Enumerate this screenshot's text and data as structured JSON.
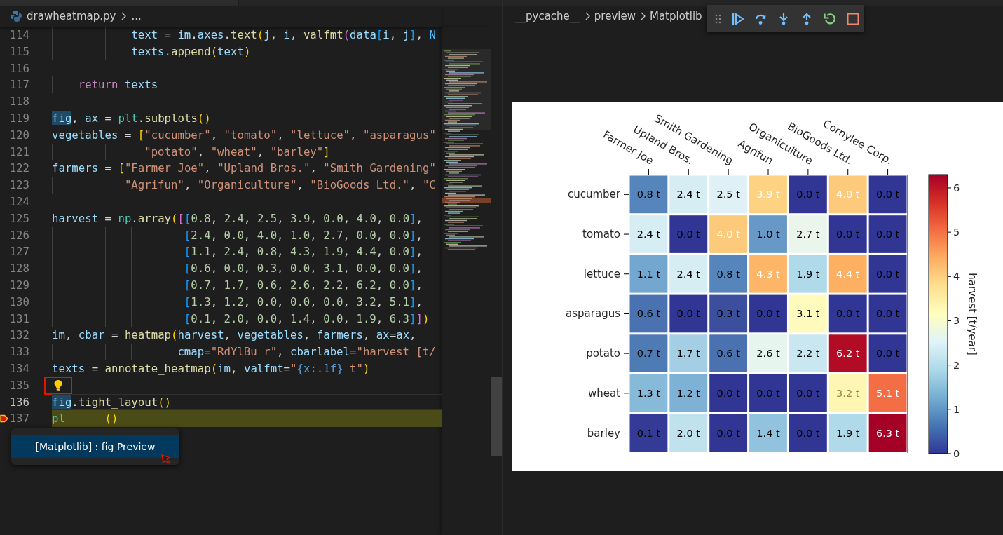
{
  "editor": {
    "file": "drawheatmap.py",
    "breadcrumb_more": "...",
    "lines": [
      {
        "number": "114",
        "current": false,
        "paused": false,
        "lightbulb": false,
        "tokens": [
          {
            "text": "            text",
            "kind": "var"
          },
          {
            "text": " = ",
            "kind": "plain"
          },
          {
            "text": "im",
            "kind": "var"
          },
          {
            "text": ".",
            "kind": "plain"
          },
          {
            "text": "axes",
            "kind": "var"
          },
          {
            "text": ".",
            "kind": "plain"
          },
          {
            "text": "text",
            "kind": "func"
          },
          {
            "text": "(",
            "kind": "b1"
          },
          {
            "text": "j",
            "kind": "var"
          },
          {
            "text": ", ",
            "kind": "plain"
          },
          {
            "text": "i",
            "kind": "var"
          },
          {
            "text": ", ",
            "kind": "plain"
          },
          {
            "text": "valfmt",
            "kind": "func"
          },
          {
            "text": "(",
            "kind": "b2"
          },
          {
            "text": "data",
            "kind": "var"
          },
          {
            "text": "[",
            "kind": "b3"
          },
          {
            "text": "i",
            "kind": "var"
          },
          {
            "text": ", ",
            "kind": "plain"
          },
          {
            "text": "j",
            "kind": "var"
          },
          {
            "text": "]",
            "kind": "b3"
          },
          {
            "text": ", ",
            "kind": "plain"
          },
          {
            "text": "N",
            "kind": "const"
          }
        ]
      },
      {
        "number": "115",
        "current": false,
        "paused": false,
        "lightbulb": false,
        "tokens": [
          {
            "text": "            texts",
            "kind": "var"
          },
          {
            "text": ".",
            "kind": "plain"
          },
          {
            "text": "append",
            "kind": "func"
          },
          {
            "text": "(",
            "kind": "b1"
          },
          {
            "text": "text",
            "kind": "var"
          },
          {
            "text": ")",
            "kind": "b1"
          }
        ]
      },
      {
        "number": "116",
        "current": false,
        "paused": false,
        "lightbulb": false
      },
      {
        "number": "117",
        "current": false,
        "paused": false,
        "lightbulb": false,
        "tokens": [
          {
            "text": "    return",
            "kind": "kw"
          },
          {
            "text": " texts",
            "kind": "var"
          }
        ]
      },
      {
        "number": "118",
        "current": false,
        "paused": false,
        "lightbulb": false
      },
      {
        "number": "119",
        "current": false,
        "paused": false,
        "lightbulb": false,
        "tokens": [
          {
            "text": "fig",
            "kind": "var",
            "highlight": true
          },
          {
            "text": ", ",
            "kind": "plain"
          },
          {
            "text": "ax",
            "kind": "var"
          },
          {
            "text": " = ",
            "kind": "plain"
          },
          {
            "text": "plt",
            "kind": "cls"
          },
          {
            "text": ".",
            "kind": "plain"
          },
          {
            "text": "subplots",
            "kind": "func"
          },
          {
            "text": "()",
            "kind": "b1"
          }
        ]
      },
      {
        "number": "120",
        "current": false,
        "paused": false,
        "lightbulb": false,
        "tokens": [
          {
            "text": "vegetables",
            "kind": "var"
          },
          {
            "text": " = ",
            "kind": "plain"
          },
          {
            "text": "[",
            "kind": "b1"
          },
          {
            "text": "\"cucumber\"",
            "kind": "str"
          },
          {
            "text": ", ",
            "kind": "plain"
          },
          {
            "text": "\"tomato\"",
            "kind": "str"
          },
          {
            "text": ", ",
            "kind": "plain"
          },
          {
            "text": "\"lettuce\"",
            "kind": "str"
          },
          {
            "text": ", ",
            "kind": "plain"
          },
          {
            "text": "\"asparagus\"",
            "kind": "str"
          }
        ]
      },
      {
        "number": "121",
        "current": false,
        "paused": false,
        "lightbulb": false,
        "tokens": [
          {
            "text": "              \"potato\"",
            "kind": "str"
          },
          {
            "text": ", ",
            "kind": "plain"
          },
          {
            "text": "\"wheat\"",
            "kind": "str"
          },
          {
            "text": ", ",
            "kind": "plain"
          },
          {
            "text": "\"barley\"",
            "kind": "str"
          },
          {
            "text": "]",
            "kind": "b1"
          }
        ]
      },
      {
        "number": "122",
        "current": false,
        "paused": false,
        "lightbulb": false,
        "tokens": [
          {
            "text": "farmers",
            "kind": "var"
          },
          {
            "text": " = ",
            "kind": "plain"
          },
          {
            "text": "[",
            "kind": "b1"
          },
          {
            "text": "\"Farmer Joe\"",
            "kind": "str"
          },
          {
            "text": ", ",
            "kind": "plain"
          },
          {
            "text": "\"Upland Bros.\"",
            "kind": "str"
          },
          {
            "text": ", ",
            "kind": "plain"
          },
          {
            "text": "\"Smith Gardening\"",
            "kind": "str"
          }
        ]
      },
      {
        "number": "123",
        "current": false,
        "paused": false,
        "lightbulb": false,
        "tokens": [
          {
            "text": "           \"Agrifun\"",
            "kind": "str"
          },
          {
            "text": ", ",
            "kind": "plain"
          },
          {
            "text": "\"Organiculture\"",
            "kind": "str"
          },
          {
            "text": ", ",
            "kind": "plain"
          },
          {
            "text": "\"BioGoods Ltd.\"",
            "kind": "str"
          },
          {
            "text": ", ",
            "kind": "plain"
          },
          {
            "text": "\"C",
            "kind": "str"
          }
        ]
      },
      {
        "number": "124",
        "current": false,
        "paused": false,
        "lightbulb": false
      },
      {
        "number": "125",
        "current": false,
        "paused": false,
        "lightbulb": false,
        "tokens": [
          {
            "text": "harvest",
            "kind": "var"
          },
          {
            "text": " = ",
            "kind": "plain"
          },
          {
            "text": "np",
            "kind": "cls"
          },
          {
            "text": ".",
            "kind": "plain"
          },
          {
            "text": "array",
            "kind": "func"
          },
          {
            "text": "(",
            "kind": "b1"
          },
          {
            "text": "[",
            "kind": "b2"
          },
          {
            "text": "[",
            "kind": "b3"
          },
          {
            "text": "0.8, 2.4, 2.5, 3.9, 0.0, 4.0, 0.0",
            "kind": "nums"
          },
          {
            "text": "]",
            "kind": "b3"
          },
          {
            "text": ",",
            "kind": "plain"
          }
        ]
      },
      {
        "number": "126",
        "current": false,
        "paused": false,
        "lightbulb": false,
        "tokens": [
          {
            "text": "                    [",
            "kind": "b3"
          },
          {
            "text": "2.4, 0.0, 4.0, 1.0, 2.7, 0.0, 0.0",
            "kind": "nums"
          },
          {
            "text": "]",
            "kind": "b3"
          },
          {
            "text": ",",
            "kind": "plain"
          }
        ]
      },
      {
        "number": "127",
        "current": false,
        "paused": false,
        "lightbulb": false,
        "tokens": [
          {
            "text": "                    [",
            "kind": "b3"
          },
          {
            "text": "1.1, 2.4, 0.8, 4.3, 1.9, 4.4, 0.0",
            "kind": "nums"
          },
          {
            "text": "]",
            "kind": "b3"
          },
          {
            "text": ",",
            "kind": "plain"
          }
        ]
      },
      {
        "number": "128",
        "current": false,
        "paused": false,
        "lightbulb": false,
        "tokens": [
          {
            "text": "                    [",
            "kind": "b3"
          },
          {
            "text": "0.6, 0.0, 0.3, 0.0, 3.1, 0.0, 0.0",
            "kind": "nums"
          },
          {
            "text": "]",
            "kind": "b3"
          },
          {
            "text": ",",
            "kind": "plain"
          }
        ]
      },
      {
        "number": "129",
        "current": false,
        "paused": false,
        "lightbulb": false,
        "tokens": [
          {
            "text": "                    [",
            "kind": "b3"
          },
          {
            "text": "0.7, 1.7, 0.6, 2.6, 2.2, 6.2, 0.0",
            "kind": "nums"
          },
          {
            "text": "]",
            "kind": "b3"
          },
          {
            "text": ",",
            "kind": "plain"
          }
        ]
      },
      {
        "number": "130",
        "current": false,
        "paused": false,
        "lightbulb": false,
        "tokens": [
          {
            "text": "                    [",
            "kind": "b3"
          },
          {
            "text": "1.3, 1.2, 0.0, 0.0, 0.0, 3.2, 5.1",
            "kind": "nums"
          },
          {
            "text": "]",
            "kind": "b3"
          },
          {
            "text": ",",
            "kind": "plain"
          }
        ]
      },
      {
        "number": "131",
        "current": false,
        "paused": false,
        "lightbulb": false,
        "tokens": [
          {
            "text": "                    [",
            "kind": "b3"
          },
          {
            "text": "0.1, 2.0, 0.0, 1.4, 0.0, 1.9, 6.3",
            "kind": "nums"
          },
          {
            "text": "]",
            "kind": "b3"
          },
          {
            "text": "]",
            "kind": "b2"
          },
          {
            "text": ")",
            "kind": "b1"
          }
        ]
      },
      {
        "number": "132",
        "current": false,
        "paused": false,
        "lightbulb": false,
        "tokens": [
          {
            "text": "im",
            "kind": "var"
          },
          {
            "text": ", ",
            "kind": "plain"
          },
          {
            "text": "cbar",
            "kind": "var"
          },
          {
            "text": " = ",
            "kind": "plain"
          },
          {
            "text": "heatmap",
            "kind": "func"
          },
          {
            "text": "(",
            "kind": "b1"
          },
          {
            "text": "harvest",
            "kind": "var"
          },
          {
            "text": ", ",
            "kind": "plain"
          },
          {
            "text": "vegetables",
            "kind": "var"
          },
          {
            "text": ", ",
            "kind": "plain"
          },
          {
            "text": "farmers",
            "kind": "var"
          },
          {
            "text": ", ",
            "kind": "plain"
          },
          {
            "text": "ax",
            "kind": "var"
          },
          {
            "text": "=",
            "kind": "plain"
          },
          {
            "text": "ax",
            "kind": "var"
          },
          {
            "text": ",",
            "kind": "plain"
          }
        ]
      },
      {
        "number": "133",
        "current": false,
        "paused": false,
        "lightbulb": false,
        "tokens": [
          {
            "text": "                   cmap",
            "kind": "var"
          },
          {
            "text": "=",
            "kind": "plain"
          },
          {
            "text": "\"RdYlBu_r\"",
            "kind": "str"
          },
          {
            "text": ", ",
            "kind": "plain"
          },
          {
            "text": "cbarlabel",
            "kind": "var"
          },
          {
            "text": "=",
            "kind": "plain"
          },
          {
            "text": "\"harvest [t/",
            "kind": "str"
          }
        ]
      },
      {
        "number": "134",
        "current": false,
        "paused": false,
        "lightbulb": false,
        "tokens": [
          {
            "text": "texts",
            "kind": "var"
          },
          {
            "text": " = ",
            "kind": "plain"
          },
          {
            "text": "annotate_heatmap",
            "kind": "func"
          },
          {
            "text": "(",
            "kind": "b1"
          },
          {
            "text": "im",
            "kind": "var"
          },
          {
            "text": ", ",
            "kind": "plain"
          },
          {
            "text": "valfmt",
            "kind": "var"
          },
          {
            "text": "=",
            "kind": "plain"
          },
          {
            "text": "\"",
            "kind": "str"
          },
          {
            "text": "{x:.1f}",
            "kind": "fmt"
          },
          {
            "text": " t\"",
            "kind": "str"
          },
          {
            "text": ")",
            "kind": "b1"
          }
        ]
      },
      {
        "number": "135",
        "current": false,
        "paused": false,
        "lightbulb": true
      },
      {
        "number": "136",
        "current": true,
        "paused": false,
        "lightbulb": false,
        "tokens": [
          {
            "text": "fig",
            "kind": "var",
            "highlight": true
          },
          {
            "text": ".",
            "kind": "plain"
          },
          {
            "text": "tight_layout",
            "kind": "func"
          },
          {
            "text": "()",
            "kind": "b1"
          }
        ]
      },
      {
        "number": "137",
        "current": false,
        "paused": true,
        "lightbulb": false,
        "tokens": [
          {
            "text": "pl",
            "kind": "cls"
          },
          {
            "text": "()",
            "kind": "b1",
            "after_gap": true
          }
        ]
      }
    ],
    "popup": {
      "label": "[Matplotlib] : fig Preview"
    }
  },
  "preview": {
    "breadcrumb": [
      "__pycache__",
      "preview",
      "Matplotlib"
    ],
    "debug_toolbar": [
      {
        "kind": "gripper"
      },
      {
        "kind": "continue"
      },
      {
        "kind": "step_over"
      },
      {
        "kind": "step_into"
      },
      {
        "kind": "step_out"
      },
      {
        "kind": "restart"
      },
      {
        "kind": "stop"
      }
    ],
    "figure": {
      "columns": [
        "Farmer Joe",
        "Upland Bros.",
        "Smith Gardening",
        "Agrifun",
        "Organiculture",
        "BioGoods Ltd.",
        "Cornylee Corp."
      ],
      "rows": [
        {
          "label": "cucumber",
          "cells": [
            {
              "text": "0.8 t",
              "color": "#5585bb",
              "light_text": false
            },
            {
              "text": "2.4 t",
              "color": "#d6edf4",
              "light_text": false
            },
            {
              "text": "2.5 t",
              "color": "#dff1f6",
              "light_text": false
            },
            {
              "text": "3.9 t",
              "color": "#fed283",
              "light_text": true
            },
            {
              "text": "0.0 t",
              "color": "#313695",
              "light_text": false
            },
            {
              "text": "4.0 t",
              "color": "#fdc97a",
              "light_text": true
            },
            {
              "text": "0.0 t",
              "color": "#313695",
              "light_text": false
            }
          ]
        },
        {
          "label": "tomato",
          "cells": [
            {
              "text": "2.4 t",
              "color": "#d6edf4",
              "light_text": false
            },
            {
              "text": "0.0 t",
              "color": "#313695",
              "light_text": false
            },
            {
              "text": "4.0 t",
              "color": "#fdc97a",
              "light_text": true
            },
            {
              "text": "1.0 t",
              "color": "#6899c6",
              "light_text": false
            },
            {
              "text": "2.7 t",
              "color": "#eaf6ec",
              "light_text": false
            },
            {
              "text": "0.0 t",
              "color": "#313695",
              "light_text": false
            },
            {
              "text": "0.0 t",
              "color": "#313695",
              "light_text": false
            }
          ]
        },
        {
          "label": "lettuce",
          "cells": [
            {
              "text": "1.1 t",
              "color": "#74a7cf",
              "light_text": false
            },
            {
              "text": "2.4 t",
              "color": "#d6edf4",
              "light_text": false
            },
            {
              "text": "0.8 t",
              "color": "#5585bb",
              "light_text": false
            },
            {
              "text": "4.3 t",
              "color": "#fdb668",
              "light_text": true
            },
            {
              "text": "1.9 t",
              "color": "#b0d9ea",
              "light_text": false
            },
            {
              "text": "4.4 t",
              "color": "#fdb062",
              "light_text": true
            },
            {
              "text": "0.0 t",
              "color": "#313695",
              "light_text": false
            }
          ]
        },
        {
          "label": "asparagus",
          "cells": [
            {
              "text": "0.6 t",
              "color": "#4a71b0",
              "light_text": false
            },
            {
              "text": "0.0 t",
              "color": "#313695",
              "light_text": false
            },
            {
              "text": "0.3 t",
              "color": "#3c4f9f",
              "light_text": false
            },
            {
              "text": "0.0 t",
              "color": "#313695",
              "light_text": false
            },
            {
              "text": "3.1 t",
              "color": "#fefbbd",
              "light_text": false
            },
            {
              "text": "0.0 t",
              "color": "#313695",
              "light_text": false
            },
            {
              "text": "0.0 t",
              "color": "#313695",
              "light_text": false
            }
          ]
        },
        {
          "label": "potato",
          "cells": [
            {
              "text": "0.7 t",
              "color": "#4f7bb5",
              "light_text": false
            },
            {
              "text": "1.7 t",
              "color": "#a3cee4",
              "light_text": false
            },
            {
              "text": "0.6 t",
              "color": "#4a71b0",
              "light_text": false
            },
            {
              "text": "2.6 t",
              "color": "#e6f5ee",
              "light_text": false
            },
            {
              "text": "2.2 t",
              "color": "#c9e7f1",
              "light_text": false
            },
            {
              "text": "6.2 t",
              "color": "#b10b26",
              "light_text": true
            },
            {
              "text": "0.0 t",
              "color": "#313695",
              "light_text": false
            }
          ]
        },
        {
          "label": "wheat",
          "cells": [
            {
              "text": "1.3 t",
              "color": "#87b9d9",
              "light_text": false
            },
            {
              "text": "1.2 t",
              "color": "#7db1d5",
              "light_text": false
            },
            {
              "text": "0.0 t",
              "color": "#313695",
              "light_text": false
            },
            {
              "text": "0.0 t",
              "color": "#313695",
              "light_text": false
            },
            {
              "text": "0.0 t",
              "color": "#313695",
              "light_text": false
            },
            {
              "text": "3.2 t",
              "color": "#fef7b3",
              "light_text": true
            },
            {
              "text": "5.1 t",
              "color": "#f36e44",
              "light_text": true
            }
          ]
        },
        {
          "label": "barley",
          "cells": [
            {
              "text": "0.1 t",
              "color": "#333b97",
              "light_text": false
            },
            {
              "text": "2.0 t",
              "color": "#bfe2ee",
              "light_text": false
            },
            {
              "text": "0.0 t",
              "color": "#313695",
              "light_text": false
            },
            {
              "text": "1.4 t",
              "color": "#92c3de",
              "light_text": false
            },
            {
              "text": "0.0 t",
              "color": "#313695",
              "light_text": false
            },
            {
              "text": "1.9 t",
              "color": "#b0d9ea",
              "light_text": false
            },
            {
              "text": "6.3 t",
              "color": "#a50026",
              "light_text": true
            }
          ]
        }
      ],
      "colorbar": {
        "label": "harvest [t/year]",
        "ticks": [
          "6",
          "5",
          "4",
          "3",
          "2",
          "1",
          "0"
        ]
      }
    }
  }
}
